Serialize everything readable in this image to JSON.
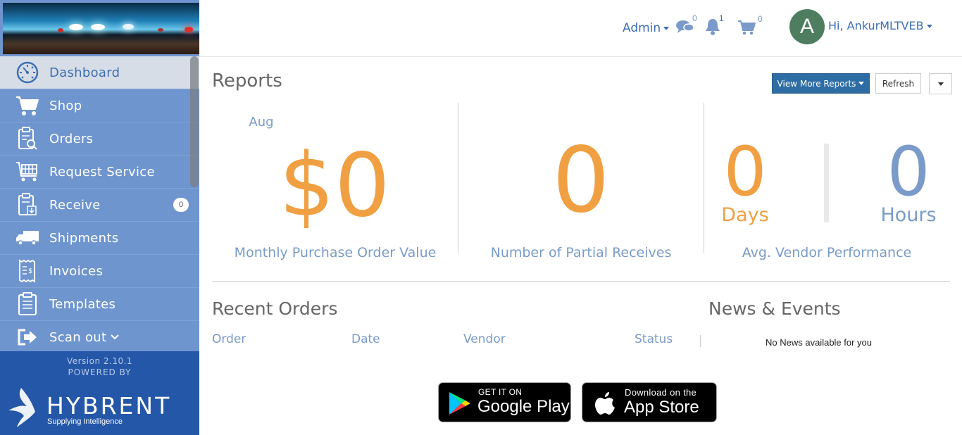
{
  "topbar": {
    "admin_label": "Admin",
    "chat_count": "0",
    "notification_count": "1",
    "cart_count": "0",
    "avatar_initial": "A",
    "greeting": "Hi, AnkurMLTVEB"
  },
  "sidebar": {
    "items": [
      {
        "label": "Dashboard",
        "icon": "dashboard-gauge-icon"
      },
      {
        "label": "Shop",
        "icon": "shopping-cart-icon"
      },
      {
        "label": "Orders",
        "icon": "clipboard-search-icon"
      },
      {
        "label": "Request Service",
        "icon": "service-cart-icon"
      },
      {
        "label": "Receive",
        "icon": "clipboard-download-icon",
        "badge": "0"
      },
      {
        "label": "Shipments",
        "icon": "truck-icon"
      },
      {
        "label": "Invoices",
        "icon": "invoice-receipt-icon"
      },
      {
        "label": "Templates",
        "icon": "clipboard-list-icon"
      },
      {
        "label": "Scan out",
        "icon": "sign-out-icon"
      }
    ],
    "version": "Version 2.10.1",
    "powered_by": "POWERED BY",
    "brand": "HYBRENT",
    "tagline": "Supplying Intelligence"
  },
  "reports": {
    "title": "Reports",
    "view_more": "View More Reports",
    "refresh": "Refresh",
    "month": "Aug",
    "purchase_value": "$0",
    "purchase_label": "Monthly Purchase Order Value",
    "partial_receives": "0",
    "partial_label": "Number of Partial Receives",
    "days_value": "0",
    "days_unit": "Days",
    "hours_value": "0",
    "hours_unit": "Hours",
    "vendor_label": "Avg. Vendor Performance"
  },
  "recent_orders": {
    "title": "Recent Orders",
    "columns": [
      "Order",
      "Date",
      "Vendor",
      "Status"
    ]
  },
  "news": {
    "title": "News & Events",
    "empty": "No News available for you"
  },
  "stores": {
    "google_small": "GET IT ON",
    "google_big": "Google Play",
    "apple_small": "Download on the",
    "apple_big": "App Store"
  },
  "colors": {
    "sidebar": "#6f95cf",
    "sidebar_active": "#d6dde6",
    "footer": "#2457a8",
    "accent_orange": "#f0a042",
    "accent_blue": "#7a9bc9",
    "primary_button": "#2e6da4"
  }
}
